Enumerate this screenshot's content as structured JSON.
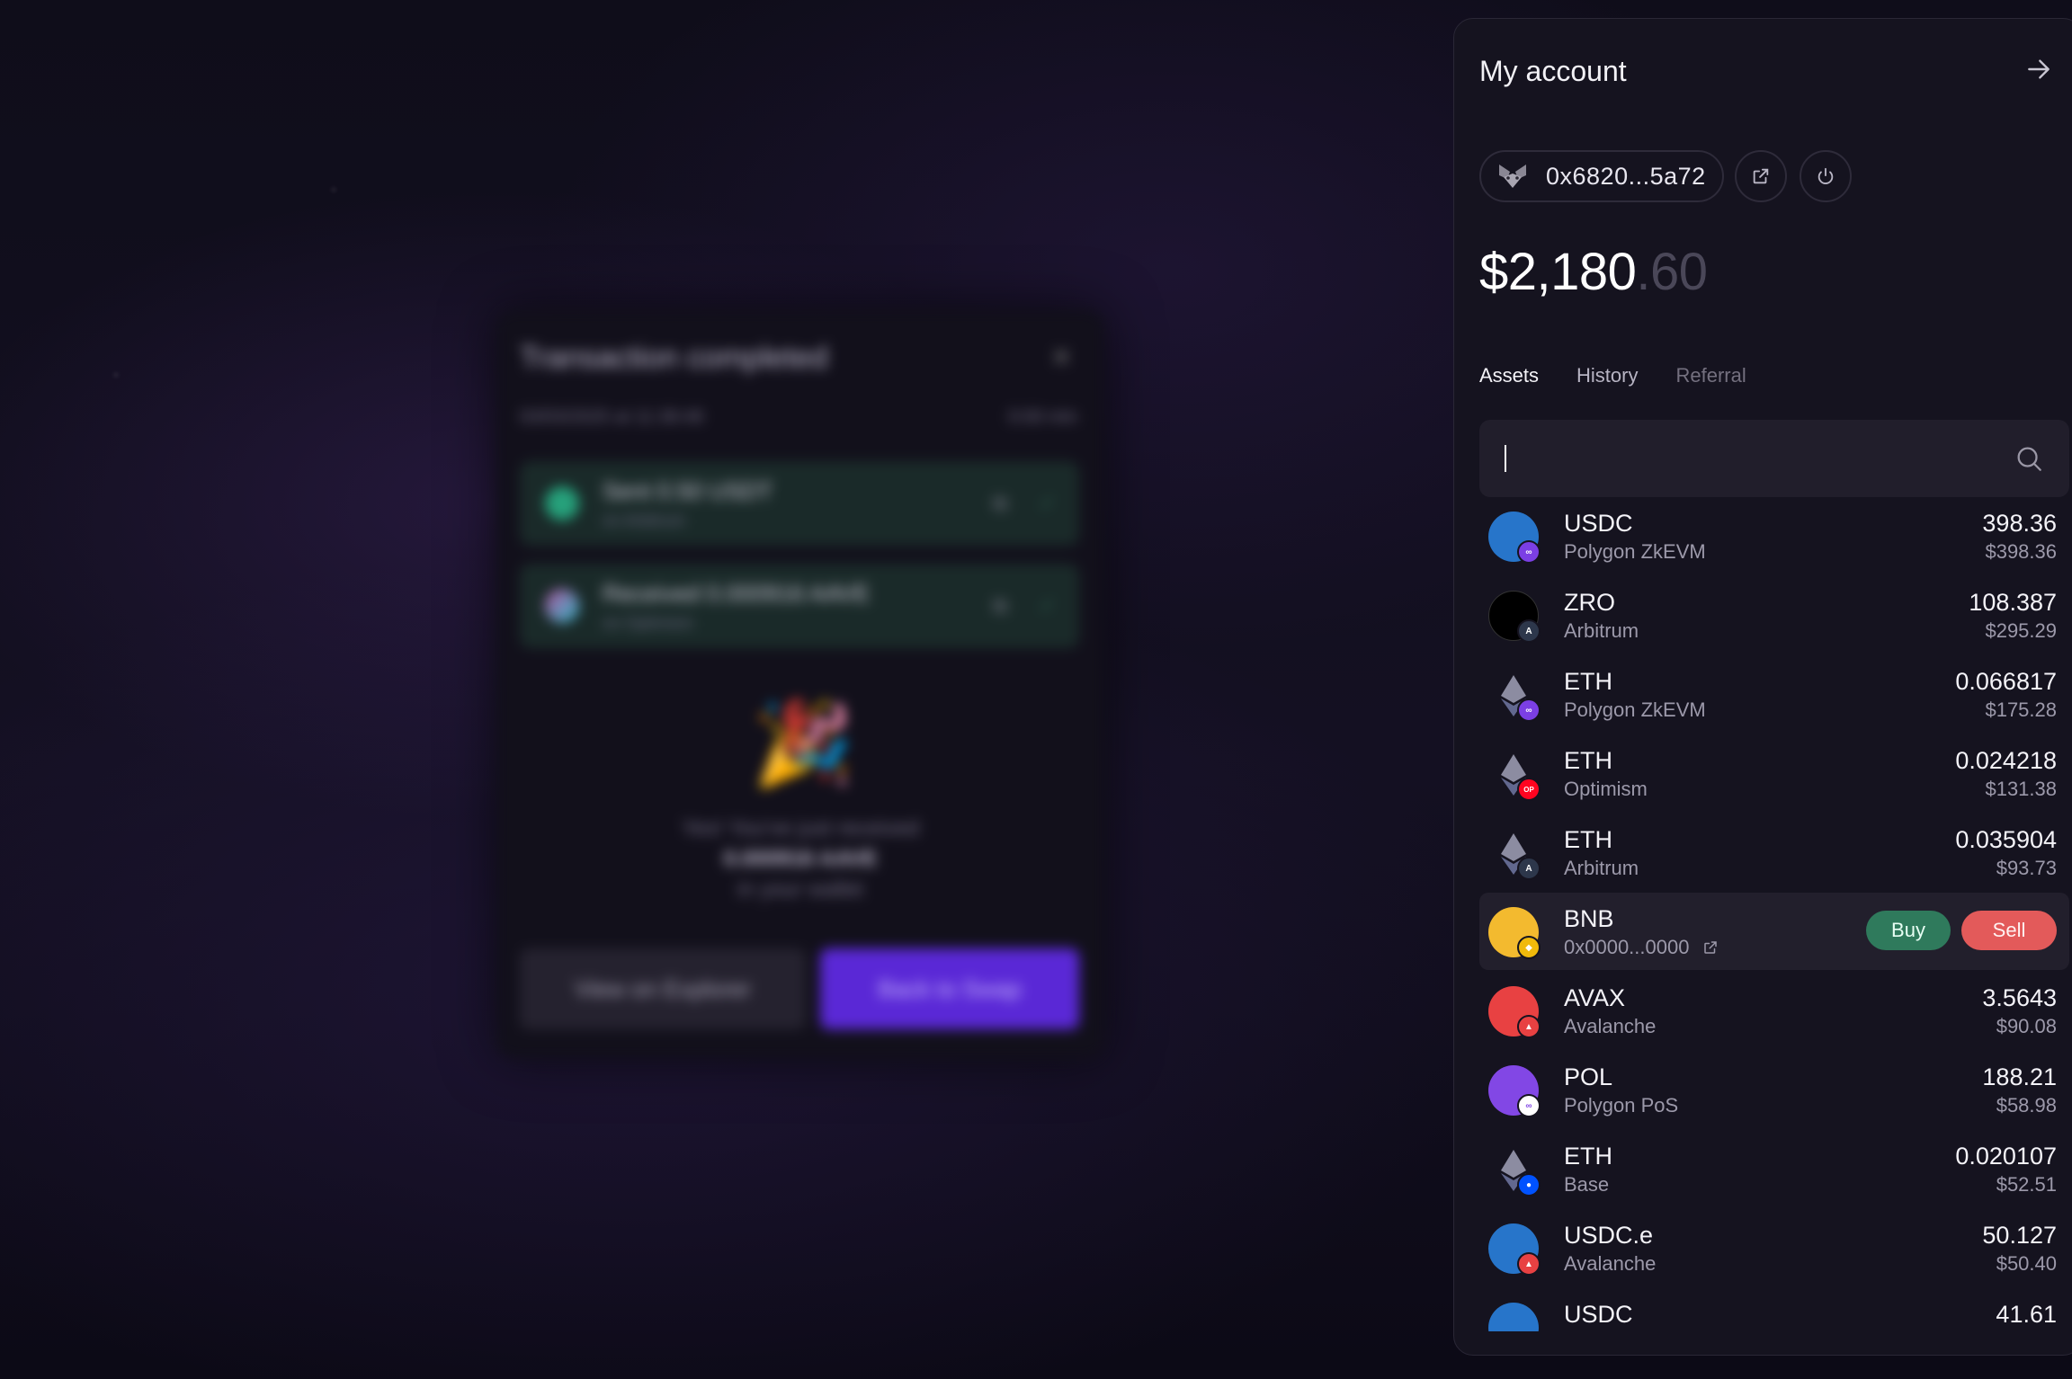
{
  "modal": {
    "title": "Transaction completed",
    "subtitle": "03/03/2025 at 11:38:48",
    "time": "0:00 min",
    "sent": {
      "label": "Sent 0.50 USDT",
      "network": "on Arbitrum"
    },
    "received": {
      "label": "Received 0.000916 AAVE",
      "network": "on Optimism"
    },
    "message_line1": "Yes! You've just received",
    "message_amount": "0.000916 AAVE",
    "message_line3": "in your wallet",
    "explorer_label": "View on Explorer",
    "back_label": "Back to Swap"
  },
  "account": {
    "title": "My account",
    "address": "0x6820...5a72",
    "balance_main": "$2,180",
    "balance_cents": ".60",
    "tabs": [
      "Assets",
      "History",
      "Referral"
    ],
    "search_placeholder": ""
  },
  "assets": [
    {
      "symbol": "USDC",
      "network": "Polygon ZkEVM",
      "amount": "398.36",
      "usd": "$398.36"
    },
    {
      "symbol": "ZRO",
      "network": "Arbitrum",
      "amount": "108.387",
      "usd": "$295.29"
    },
    {
      "symbol": "ETH",
      "network": "Polygon ZkEVM",
      "amount": "0.066817",
      "usd": "$175.28"
    },
    {
      "symbol": "ETH",
      "network": "Optimism",
      "amount": "0.024218",
      "usd": "$131.38"
    },
    {
      "symbol": "ETH",
      "network": "Arbitrum",
      "amount": "0.035904",
      "usd": "$93.73"
    },
    {
      "symbol": "BNB",
      "network": "0x0000...0000",
      "buy": "Buy",
      "sell": "Sell"
    },
    {
      "symbol": "AVAX",
      "network": "Avalanche",
      "amount": "3.5643",
      "usd": "$90.08"
    },
    {
      "symbol": "POL",
      "network": "Polygon PoS",
      "amount": "188.21",
      "usd": "$58.98"
    },
    {
      "symbol": "ETH",
      "network": "Base",
      "amount": "0.020107",
      "usd": "$52.51"
    },
    {
      "symbol": "USDC.e",
      "network": "Avalanche",
      "amount": "50.127",
      "usd": "$50.40"
    },
    {
      "symbol": "USDC",
      "network": "",
      "amount": "41.61",
      "usd": ""
    }
  ],
  "colors": {
    "accent_purple": "#5a28d6",
    "buy_green": "#2f7a5c",
    "sell_red": "#e35a5a",
    "panel_bg": "#15131f"
  },
  "icons": [
    "arrow-right-icon",
    "metamask-fox-icon",
    "external-link-icon",
    "power-icon",
    "search-icon"
  ]
}
